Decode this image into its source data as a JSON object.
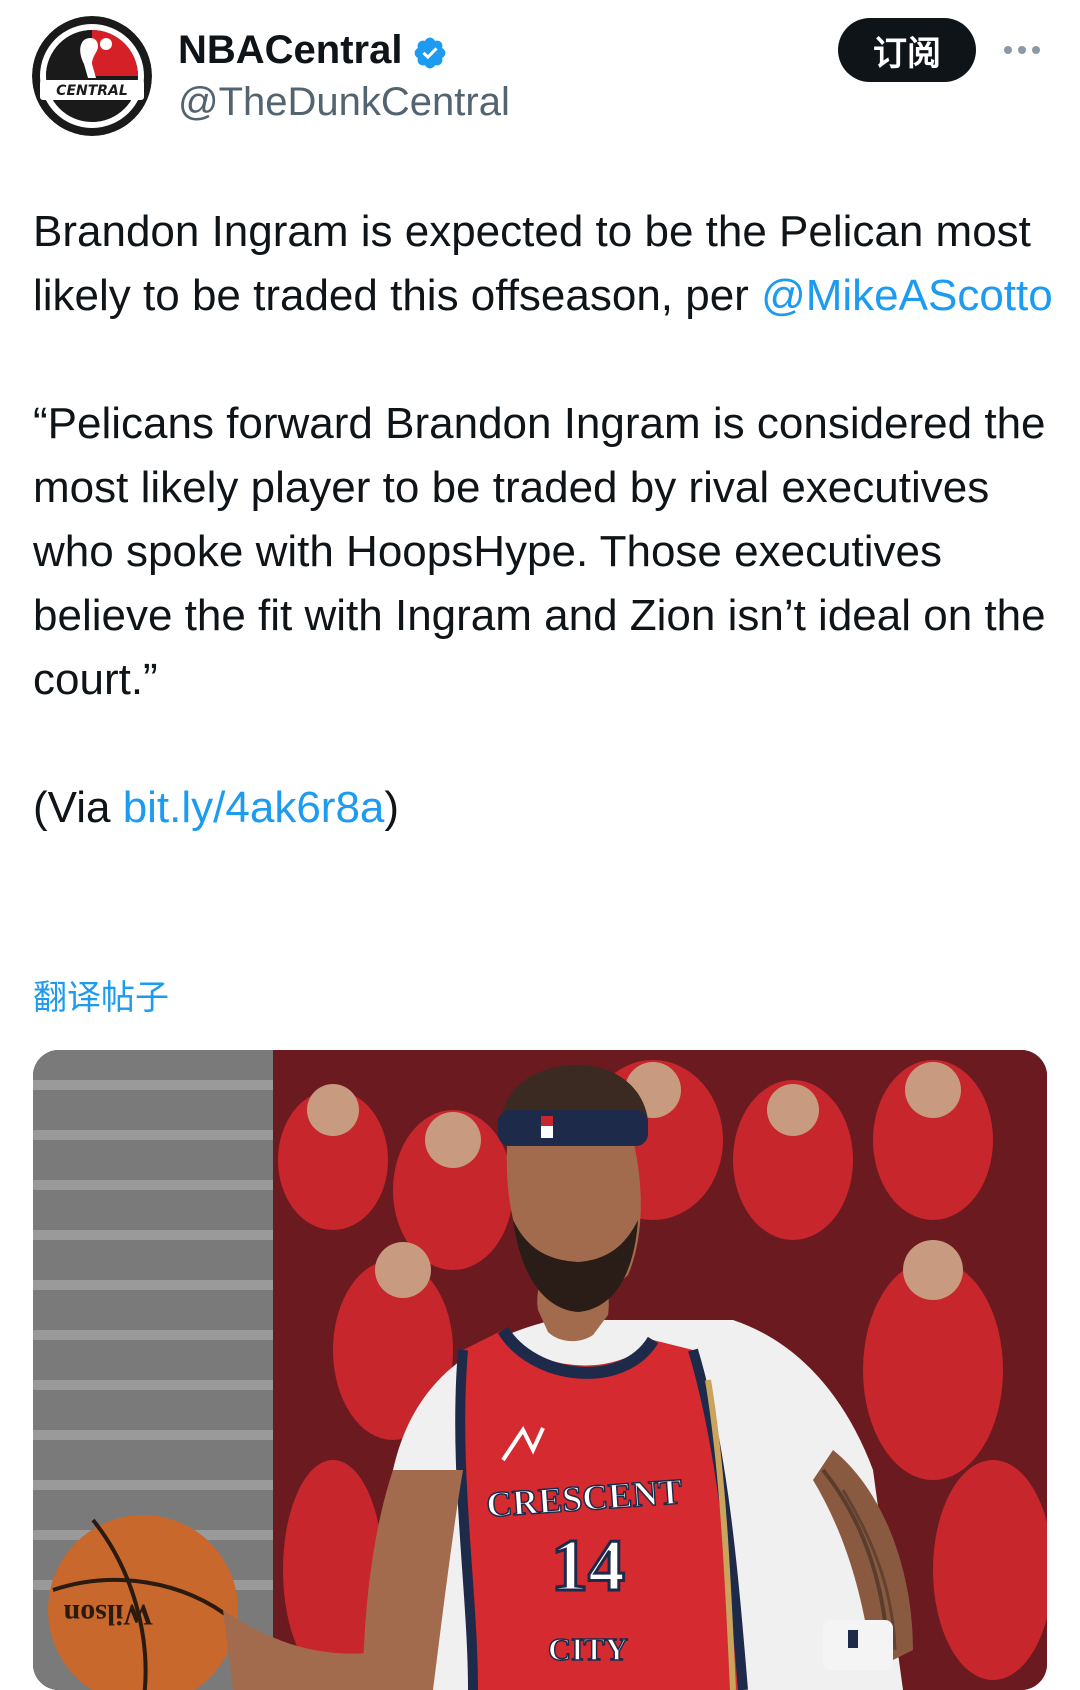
{
  "author": {
    "display_name": "NBACentral",
    "handle": "@TheDunkCentral",
    "avatar_text": "CENTRAL"
  },
  "actions": {
    "subscribe_label": "订阅",
    "more_icon": "more-dots-icon"
  },
  "tweet": {
    "line1_text": "Brandon Ingram is expected to be the Pelican most likely to be traded this offseason, per ",
    "mention": "@MikeAScotto",
    "quote": "“Pelicans forward Brandon Ingram is considered the most likely player to be traded by rival executives who spoke with HoopsHype. Those executives believe the fit with Ingram and Zion isn’t ideal on the court.”",
    "via_prefix": "(Via ",
    "via_link": "bit.ly/4ak6r8a",
    "via_suffix": ")"
  },
  "translate_label": "翻译帖子",
  "media": {
    "jersey_word": "CRESCENT",
    "jersey_number": "14",
    "jersey_city": "CITY",
    "ball_brand": "Wilson"
  },
  "colors": {
    "link": "#1d9bf0",
    "text": "#0f1419",
    "secondary": "#536471",
    "button_bg": "#0f1419",
    "verified": "#1d9bf0"
  }
}
